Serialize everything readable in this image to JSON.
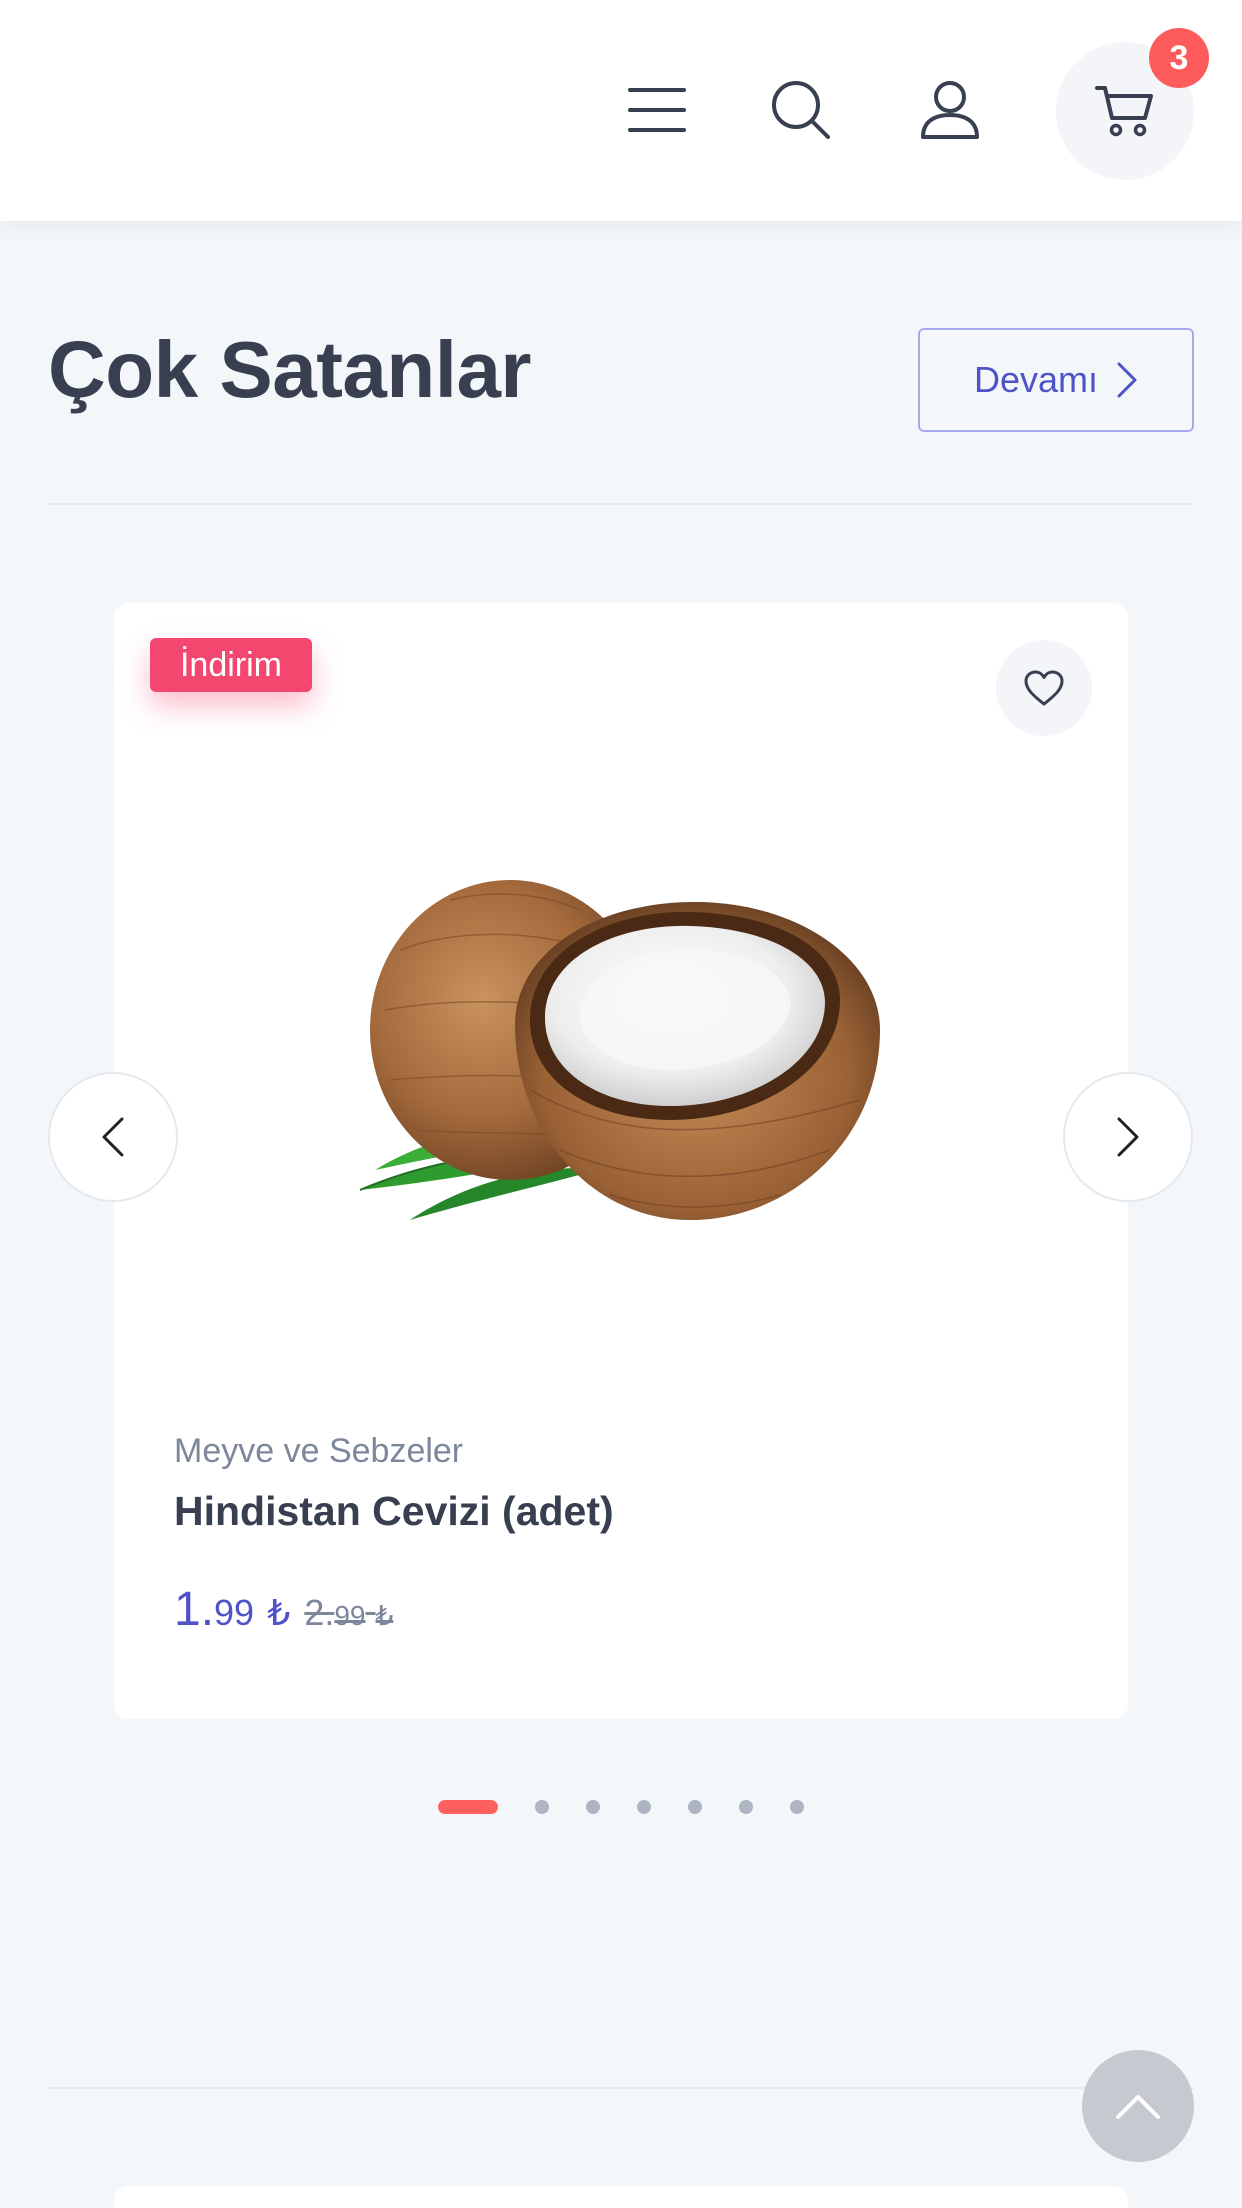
{
  "header": {
    "menu_icon": "hamburger-menu-icon",
    "search_icon": "search-icon",
    "account_icon": "user-icon",
    "cart_icon": "cart-icon",
    "cart_count": "3"
  },
  "section": {
    "title": "Çok Satanlar",
    "more_label": "Devamı"
  },
  "product": {
    "badge": "İndirim",
    "category": "Meyve ve Sebzeler",
    "name": "Hindistan Cevizi (adet)",
    "price_int": "1.",
    "price_dec": "99",
    "price_currency": "₺",
    "old_price_int": "2.",
    "old_price_dec": "99",
    "old_price_currency": "₺",
    "image": "coconut-image"
  },
  "carousel": {
    "total_slides": 7,
    "active_slide": 1
  },
  "colors": {
    "accent": "#4e54c8",
    "sale": "#f34770",
    "badge": "#fe5c5c",
    "heading": "#373f50",
    "muted": "#7d879c",
    "background": "#f4f7fa"
  }
}
